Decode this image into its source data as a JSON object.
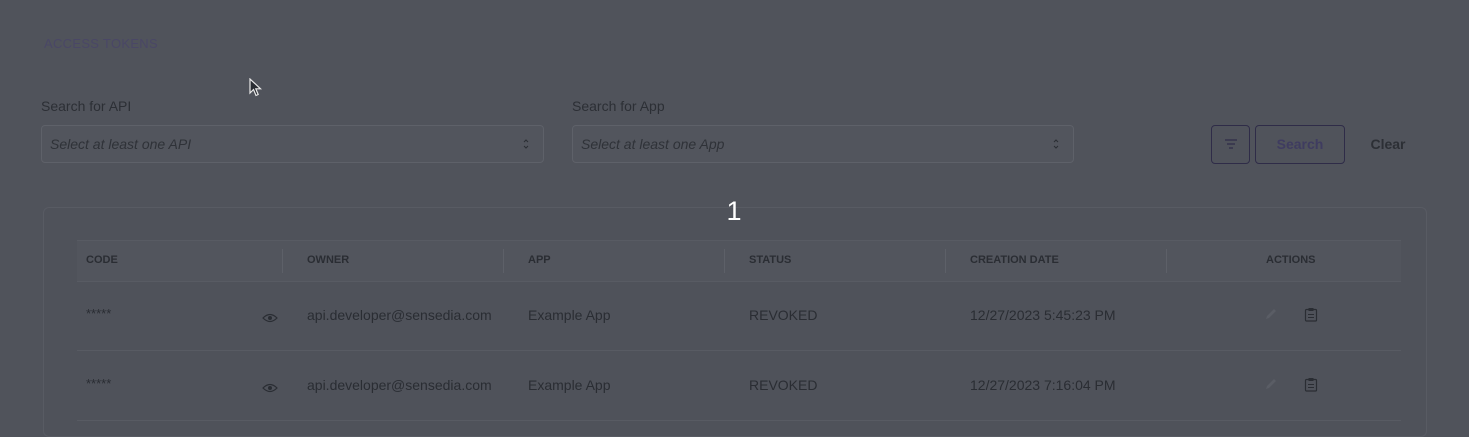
{
  "page": {
    "title": "ACCESS TOKENS"
  },
  "filters": {
    "api": {
      "label": "Search for API",
      "placeholder": "Select at least one API"
    },
    "app": {
      "label": "Search for App",
      "placeholder": "Select at least one App"
    },
    "search_label": "Search",
    "clear_label": "Clear"
  },
  "step_marker": "1",
  "table": {
    "columns": [
      "CODE",
      "OWNER",
      "APP",
      "STATUS",
      "CREATION DATE",
      "ACTIONS"
    ],
    "rows": [
      {
        "code": "*****",
        "owner": "api.developer@sensedia.com",
        "app": "Example App",
        "status": "REVOKED",
        "created": "12/27/2023 5:45:23 PM"
      },
      {
        "code": "*****",
        "owner": "api.developer@sensedia.com",
        "app": "Example App",
        "status": "REVOKED",
        "created": "12/27/2023 7:16:04 PM"
      }
    ]
  },
  "icons": {
    "filter": "filter-lines-icon",
    "reveal": "eye-icon",
    "edit": "pencil-icon",
    "copy": "clipboard-icon",
    "select_arrows": "up-down-chevron-icon"
  }
}
